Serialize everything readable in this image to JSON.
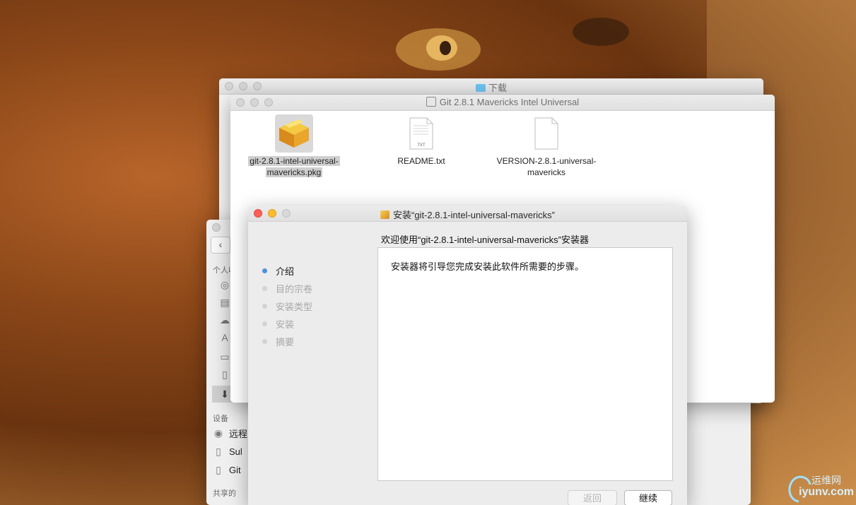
{
  "windows": {
    "downloads": {
      "title": "下载"
    },
    "sidebar": {
      "section_personal": "个人收",
      "section_devices": "设备",
      "section_shared": "共享的",
      "devices": [
        "远程",
        "Sul",
        "Git"
      ]
    },
    "git_folder": {
      "title": "Git 2.8.1 Mavericks Intel Universal",
      "files": [
        {
          "line1": "git-2.8.1-intel-universal-",
          "line2": "mavericks.pkg",
          "icon": "package-icon"
        },
        {
          "line1": "README.txt",
          "line2": "",
          "icon": "txt-document-icon"
        },
        {
          "line1": "VERSION-2.8.1-universal-",
          "line2": "mavericks",
          "icon": "blank-document-icon"
        }
      ]
    },
    "installer": {
      "title": "安装“git-2.8.1-intel-universal-mavericks”",
      "heading": "欢迎使用“git-2.8.1-intel-universal-mavericks”安装器",
      "body": "安装器将引导您完成安装此软件所需要的步骤。",
      "steps": [
        "介绍",
        "目的宗卷",
        "安装类型",
        "安装",
        "摘要"
      ],
      "active_step": 0,
      "back_label": "返回",
      "continue_label": "继续"
    }
  },
  "watermark": {
    "line1": "运维网",
    "line2": "iyunv.com"
  },
  "colors": {
    "accent": "#4a90e2",
    "close": "#fc5f57",
    "minimize": "#fdbc2e"
  }
}
